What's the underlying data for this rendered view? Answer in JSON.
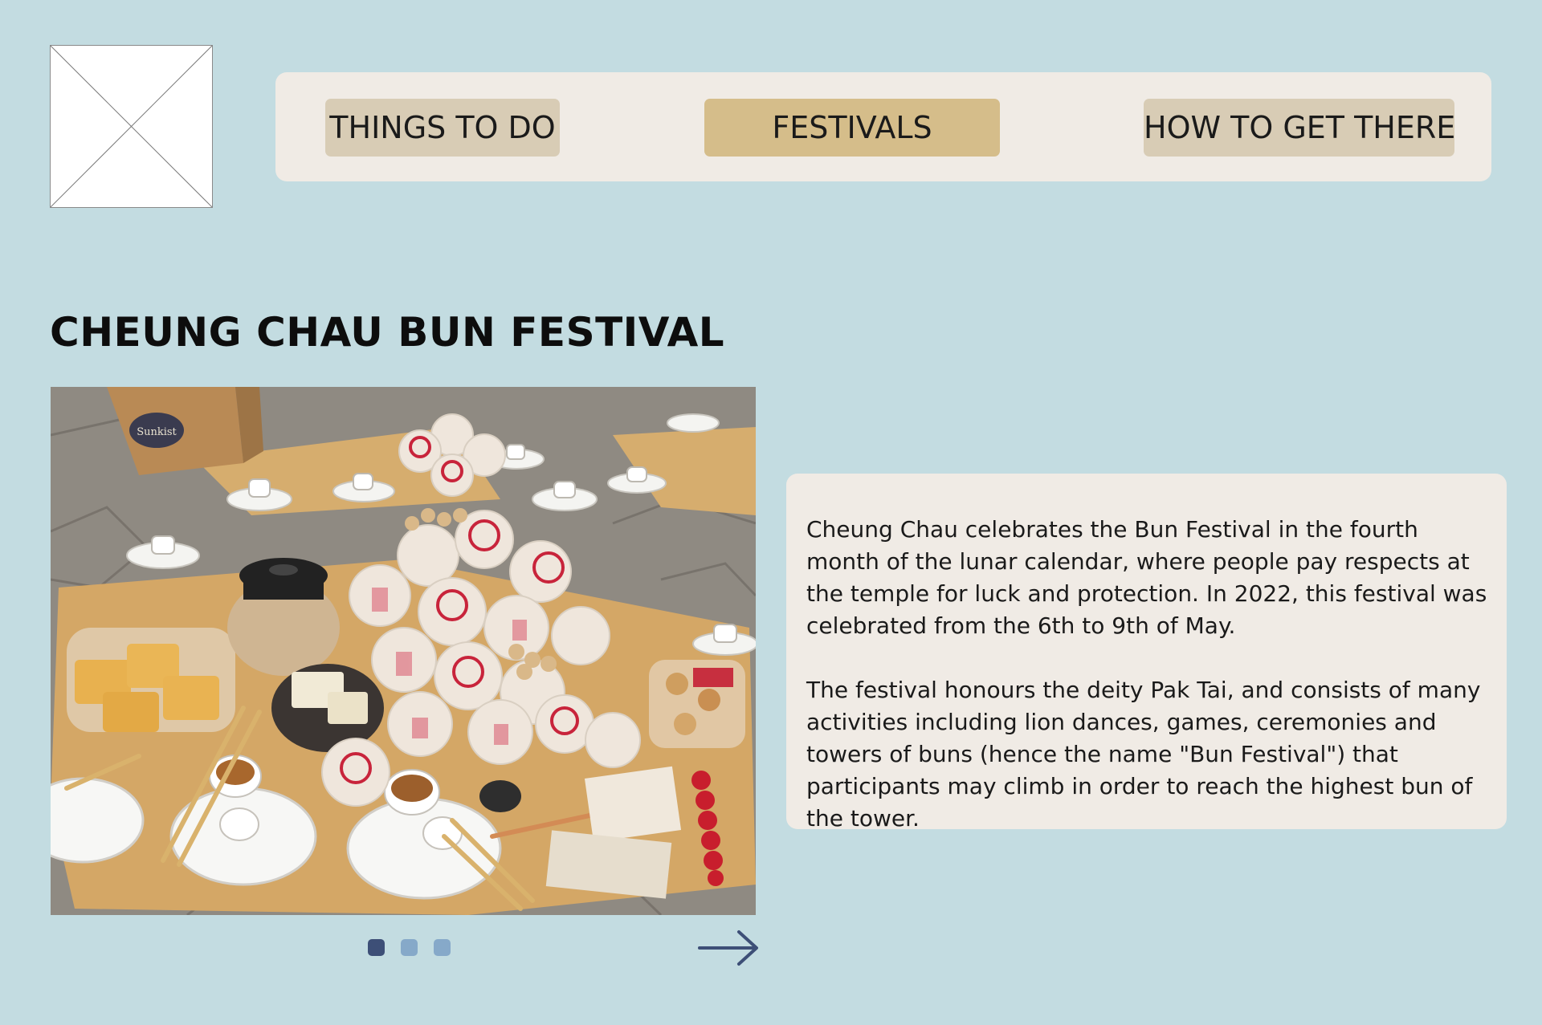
{
  "logo": {
    "icon": "image-placeholder-icon"
  },
  "nav": {
    "items": [
      {
        "label": "THINGS TO DO",
        "active": false
      },
      {
        "label": "FESTIVALS",
        "active": true
      },
      {
        "label": "HOW TO GET THERE",
        "active": false
      }
    ]
  },
  "main": {
    "title": "CHEUNG CHAU BUN FESTIVAL",
    "photo": {
      "box_label": "Sunkist"
    },
    "carousel": {
      "slide_count": 3,
      "current_slide": 1,
      "next_icon": "arrow-right-icon"
    },
    "description": {
      "paragraphs": [
        "Cheung Chau celebrates the Bun Festival in the fourth month of the lunar calendar, where people pay respects at the temple for luck and protection. In 2022, this festival was celebrated from the 6th to 9th of May.",
        "The festival honours the deity Pak Tai, and consists of many activities including lion dances, games, ceremonies and towers of buns (hence the name \"Bun Festival\") that participants may climb in order to reach the highest bun of the tower."
      ]
    }
  },
  "colors": {
    "background": "#c3dce1",
    "card": "#f0ebe5",
    "nav_button": "#d8ccb5",
    "nav_button_active": "#d5bd8a",
    "dot_active": "#3d4f77",
    "dot_inactive": "#86a9c9",
    "arrow": "#3d4f77"
  }
}
